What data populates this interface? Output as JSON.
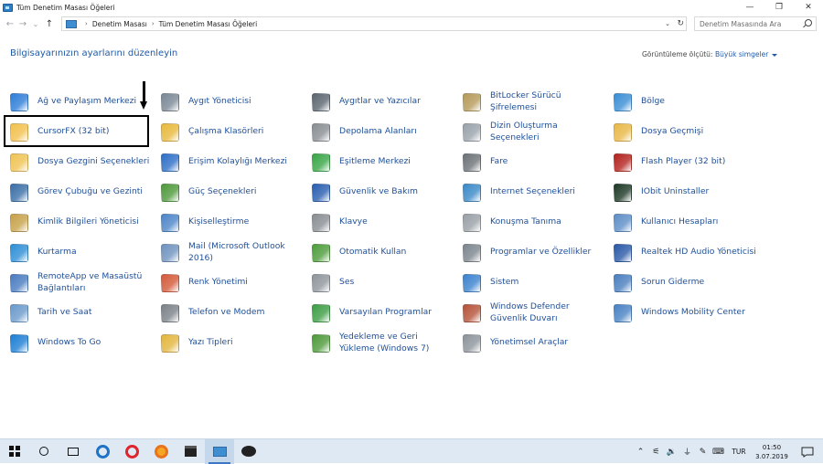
{
  "window": {
    "title": "Tüm Denetim Masası Öğeleri",
    "minimize": "—",
    "restore": "❐",
    "close": "✕"
  },
  "nav": {
    "back": "←",
    "forward": "→",
    "history": "⌄",
    "up": "↑"
  },
  "address": {
    "segments": [
      "Denetim Masası",
      "Tüm Denetim Masası Öğeleri"
    ],
    "separator": "›"
  },
  "search": {
    "placeholder": "Denetim Masasında Ara"
  },
  "main": {
    "heading": "Bilgisayarınızın ayarlarını düzenleyin",
    "view_by_label": "Görüntüleme ölçütü:",
    "view_by_value": "Büyük simgeler"
  },
  "items": [
    {
      "label": "Ağ ve Paylaşım Merkezi",
      "icon": "network-icon",
      "color": "#2f7ed8"
    },
    {
      "label": "Aygıt Yöneticisi",
      "icon": "device-manager-icon",
      "color": "#7a8896"
    },
    {
      "label": "Aygıtlar ve Yazıcılar",
      "icon": "printer-icon",
      "color": "#5d6670"
    },
    {
      "label": "BitLocker Sürücü Şifrelemesi",
      "icon": "bitlocker-icon",
      "color": "#b59a5a"
    },
    {
      "label": "Bölge",
      "icon": "globe-icon",
      "color": "#3b8fd6"
    },
    {
      "label": "CursorFX (32 bit)",
      "icon": "folder-icon",
      "color": "#f2c14e"
    },
    {
      "label": "Çalışma Klasörleri",
      "icon": "work-folders-icon",
      "color": "#e8b93c"
    },
    {
      "label": "Depolama Alanları",
      "icon": "storage-icon",
      "color": "#8a8f94"
    },
    {
      "label": "Dizin Oluşturma Seçenekleri",
      "icon": "indexing-icon",
      "color": "#9aa3ab"
    },
    {
      "label": "Dosya Geçmişi",
      "icon": "file-history-icon",
      "color": "#e9b949"
    },
    {
      "label": "Dosya Gezgini Seçenekleri",
      "icon": "folder-options-icon",
      "color": "#f0c455"
    },
    {
      "label": "Erişim Kolaylığı Merkezi",
      "icon": "accessibility-icon",
      "color": "#2e6fc7"
    },
    {
      "label": "Eşitleme Merkezi",
      "icon": "sync-icon",
      "color": "#3aa648"
    },
    {
      "label": "Fare",
      "icon": "mouse-icon",
      "color": "#6d7378"
    },
    {
      "label": "Flash Player (32 bit)",
      "icon": "flash-icon",
      "color": "#b3241f"
    },
    {
      "label": "Görev Çubuğu ve Gezinti",
      "icon": "taskbar-icon",
      "color": "#3c6fa8"
    },
    {
      "label": "Güç Seçenekleri",
      "icon": "power-icon",
      "color": "#4f9a3c"
    },
    {
      "label": "Güvenlik ve Bakım",
      "icon": "flag-icon",
      "color": "#2b5fb0"
    },
    {
      "label": "Internet Seçenekleri",
      "icon": "internet-options-icon",
      "color": "#3c8ac8"
    },
    {
      "label": "IObit Uninstaller",
      "icon": "iobit-icon",
      "color": "#1f3a28"
    },
    {
      "label": "Kimlik Bilgileri Yöneticisi",
      "icon": "credentials-icon",
      "color": "#c7a24a"
    },
    {
      "label": "Kişiselleştirme",
      "icon": "personalization-icon",
      "color": "#4e86c9"
    },
    {
      "label": "Klavye",
      "icon": "keyboard-icon",
      "color": "#8a8f94"
    },
    {
      "label": "Konuşma Tanıma",
      "icon": "microphone-icon",
      "color": "#9aa1a7"
    },
    {
      "label": "Kullanıcı Hesapları",
      "icon": "users-icon",
      "color": "#5f8fc7"
    },
    {
      "label": "Kurtarma",
      "icon": "recovery-icon",
      "color": "#2f8fd6"
    },
    {
      "label": "Mail (Microsoft Outlook 2016)",
      "icon": "mail-icon",
      "color": "#6f93c0"
    },
    {
      "label": "Otomatik Kullan",
      "icon": "autoplay-icon",
      "color": "#4f9d3d"
    },
    {
      "label": "Programlar ve Özellikler",
      "icon": "programs-icon",
      "color": "#7d868f"
    },
    {
      "label": "Realtek HD Audio Yöneticisi",
      "icon": "realtek-icon",
      "color": "#2c5aa8"
    },
    {
      "label": "RemoteApp ve Masaüstü Bağlantıları",
      "icon": "remoteapp-icon",
      "color": "#4a7cc0"
    },
    {
      "label": "Renk Yönetimi",
      "icon": "color-management-icon",
      "color": "#d45a3a"
    },
    {
      "label": "Ses",
      "icon": "speaker-icon",
      "color": "#8f969c"
    },
    {
      "label": "Sistem",
      "icon": "system-icon",
      "color": "#3d83cf"
    },
    {
      "label": "Sorun Giderme",
      "icon": "troubleshoot-icon",
      "color": "#4b7fbf"
    },
    {
      "label": "Tarih ve Saat",
      "icon": "clock-icon",
      "color": "#6b9acb"
    },
    {
      "label": "Telefon ve Modem",
      "icon": "phone-icon",
      "color": "#7b8289"
    },
    {
      "label": "Varsayılan Programlar",
      "icon": "default-programs-icon",
      "color": "#3e9e46"
    },
    {
      "label": "Windows Defender Güvenlik Duvarı",
      "icon": "firewall-icon",
      "color": "#b5533a"
    },
    {
      "label": "Windows Mobility Center",
      "icon": "mobility-icon",
      "color": "#4a83c4"
    },
    {
      "label": "Windows To Go",
      "icon": "windows-to-go-icon",
      "color": "#1f7fd4"
    },
    {
      "label": "Yazı Tipleri",
      "icon": "fonts-icon",
      "color": "#e3b63e"
    },
    {
      "label": "Yedekleme ve Geri Yükleme (Windows 7)",
      "icon": "backup-icon",
      "color": "#4f9a3c"
    },
    {
      "label": "Yönetimsel Araçlar",
      "icon": "admin-tools-icon",
      "color": "#8d959c"
    }
  ],
  "taskbar": {
    "apps": [
      {
        "icon": "start-icon",
        "color": "#111111"
      },
      {
        "icon": "search-icon",
        "color": "#111111"
      },
      {
        "icon": "task-view-icon",
        "color": "#111111"
      },
      {
        "icon": "edge-icon",
        "color": "#1e73c9"
      },
      {
        "icon": "opera-icon",
        "color": "#e0242b"
      },
      {
        "icon": "firefox-icon",
        "color": "#e8731d"
      },
      {
        "icon": "store-icon",
        "color": "#222222"
      },
      {
        "icon": "control-panel-icon",
        "color": "#3f8ed2"
      },
      {
        "icon": "app-icon",
        "color": "#222222"
      }
    ],
    "language": "TUR",
    "time": "01:50",
    "date": "3.07.2019"
  }
}
